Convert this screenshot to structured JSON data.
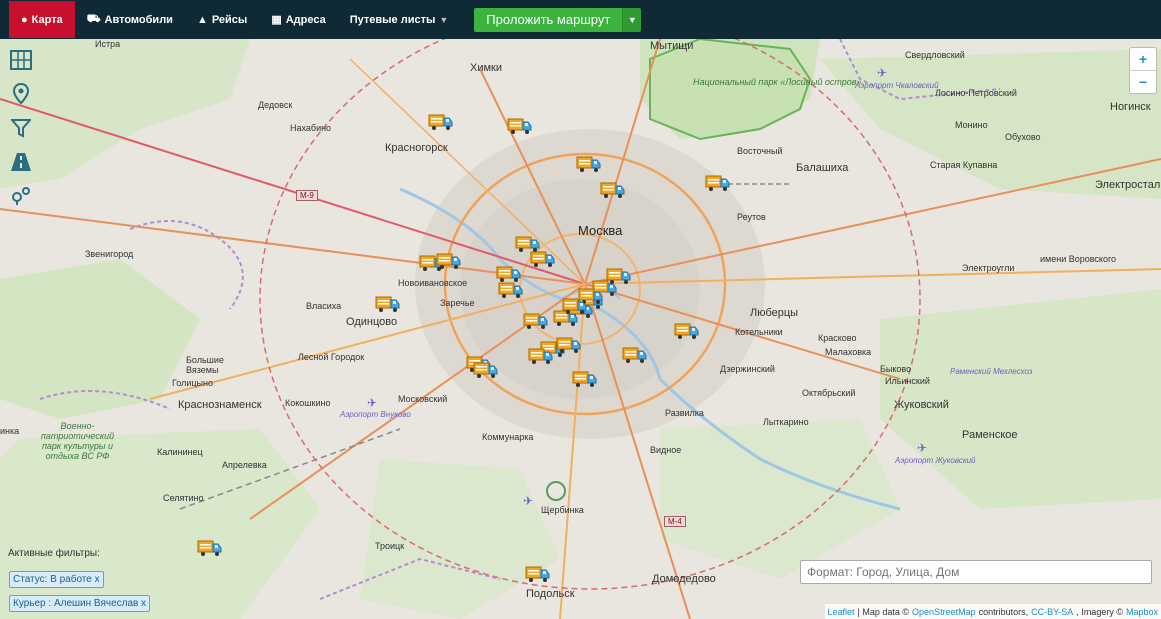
{
  "navbar": {
    "items": [
      {
        "label": "Карта",
        "icon": "map-marker-icon",
        "active": true
      },
      {
        "label": "Автомобили",
        "icon": "truck-icon"
      },
      {
        "label": "Рейсы",
        "icon": "road-icon"
      },
      {
        "label": "Адреса",
        "icon": "building-icon"
      },
      {
        "label": "Путевые листы",
        "icon": "caret-down-icon"
      }
    ],
    "route_button": "Проложить маршрут",
    "colors": {
      "bar": "#0f2a35",
      "active": "#c8102e",
      "route": "#3bb33e"
    }
  },
  "map": {
    "labels": {
      "istra": "Истра",
      "mytishchi": "Мытищи",
      "khimki": "Химки",
      "sverdlovsky": "Свердловский",
      "national_park": "Национальный парк «Лосиный остров»",
      "airport_chkalovsky": "Аэропорт Чкаловский",
      "losino": "Лосино-Петровский",
      "noginsk": "Ногинск",
      "dedovsk": "Дедовск",
      "nakhabino": "Нахабино",
      "krasnogorsk": "Красногорск",
      "monino": "Монино",
      "obukhovo": "Обухово",
      "vostochny": "Восточный",
      "balashikha": "Балашиха",
      "staraya_kupavna": "Старая Купавна",
      "elektrostal": "Электростал",
      "m9": "M-9",
      "reutov": "Реутов",
      "moskva": "Москва",
      "zvenigorod": "Звенигород",
      "elektrougli": "Электроугли",
      "vorovskogo": "имени Воровского",
      "novoivanovskoe": "Новоивановское",
      "zarechye": "Заречье",
      "vlasikha": "Власиха",
      "odintsovo": "Одинцово",
      "lyubertsy": "Люберцы",
      "kotelniki": "Котельники",
      "kraskovo": "Красково",
      "malakhovka": "Малаховка",
      "bolshie_vyazemy": "Большие Вяземы",
      "lesnoy_gorodok": "Лесной Городок",
      "golitsyno": "Голицыно",
      "dzerzhinsky": "Дзержинский",
      "bykovo": "Быково",
      "ilyinsky": "Ильинский",
      "ramensky_mkhz": "Раменский Мехлесхоз",
      "oktyabrsky": "Октябрьский",
      "krasnoznamensk": "Краснознаменск",
      "kokoshkino": "Кокошкино",
      "moskovsky": "Московский",
      "zhukovsky": "Жуковский",
      "airport_vnukovo": "Аэропорт Внуково",
      "razvilka": "Развилка",
      "lytkarino": "Лыткарино",
      "ramenskoe": "Раменское",
      "inka": "инка",
      "voenno_park": "Военно-патриотический парк культуры и отдыха ВС РФ",
      "kommunarka": "Коммунарка",
      "airport_zhukovsky": "Аэропорт Жуковский",
      "kalininets": "Калининец",
      "aprelevka": "Апрелевка",
      "vidnoe": "Видное",
      "selyatino": "Селятино",
      "shcherbinka": "Щербинка",
      "m4": "M-4",
      "troitsk": "Троицк",
      "domodedovo": "Домодедово",
      "podolsk": "Подольск"
    },
    "trucks": [
      {
        "id": 1
      },
      {
        "id": 2
      },
      {
        "id": 3
      },
      {
        "id": 4
      },
      {
        "id": 5
      },
      {
        "id": 6
      },
      {
        "id": 7
      },
      {
        "id": 8
      },
      {
        "id": 9
      },
      {
        "id": 10
      },
      {
        "id": 11
      },
      {
        "id": 12
      },
      {
        "id": 13
      },
      {
        "id": 14
      },
      {
        "id": 15
      },
      {
        "id": 16
      },
      {
        "id": 17
      },
      {
        "id": 18
      },
      {
        "id": 19
      },
      {
        "id": 20
      },
      {
        "id": 21
      },
      {
        "id": 22
      },
      {
        "id": 23
      },
      {
        "id": 24
      },
      {
        "id": 25
      },
      {
        "id": 26
      },
      {
        "id": 27
      },
      {
        "id": 28
      },
      {
        "id": 29
      },
      {
        "id": 30
      }
    ]
  },
  "filters": {
    "title": "Активные фильтры:",
    "chips": [
      "Статус: В работе x",
      "Курьер : Алешин Вячеслав x"
    ]
  },
  "search": {
    "placeholder": "Формат: Город, Улица, Дом"
  },
  "zoom": {
    "in": "+",
    "out": "−"
  },
  "attribution": {
    "leaflet": "Leaflet",
    "sep": "| Map data ©",
    "osm": "OpenStreetMap",
    "contrib": "contributors,",
    "license": "CC-BY-SA",
    "imagery": ", Imagery ©",
    "mapbox": "Mapbox"
  }
}
